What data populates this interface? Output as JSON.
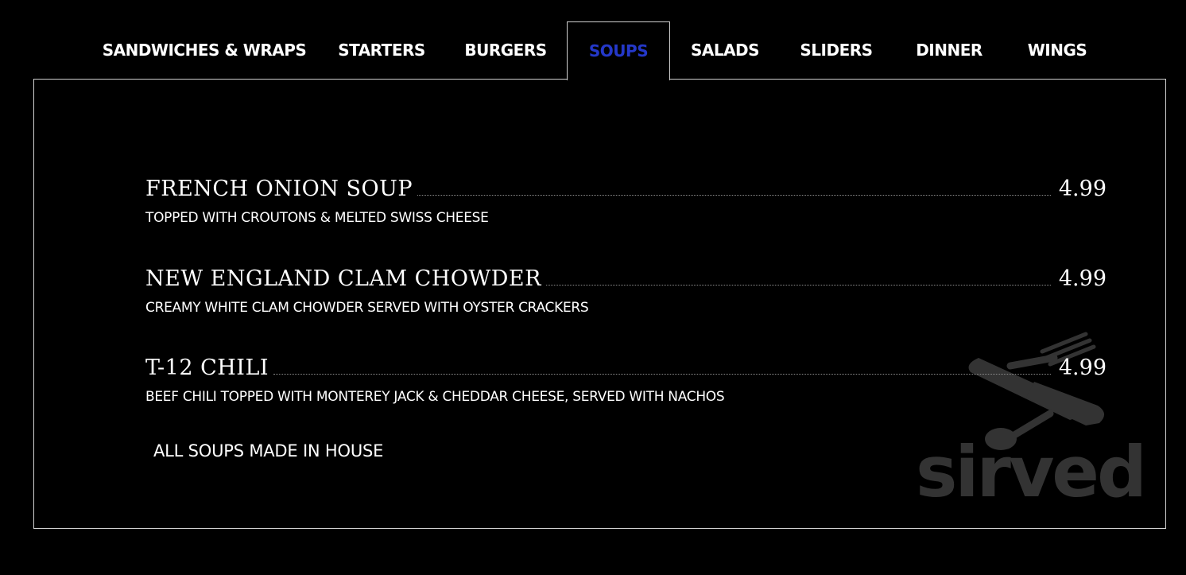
{
  "tabs": [
    {
      "label": "SANDWICHES & WRAPS",
      "active": false
    },
    {
      "label": "STARTERS",
      "active": false
    },
    {
      "label": "BURGERS",
      "active": false
    },
    {
      "label": "SOUPS",
      "active": true
    },
    {
      "label": "SALADS",
      "active": false
    },
    {
      "label": "SLIDERS",
      "active": false
    },
    {
      "label": "DINNER",
      "active": false
    },
    {
      "label": "WINGS",
      "active": false
    }
  ],
  "colors": {
    "background": "#000000",
    "text": "#ffffff",
    "active_tab": "#2438c9",
    "border": "#d0d0d0",
    "watermark": "#333333"
  },
  "menu": {
    "items": [
      {
        "name": "FRENCH ONION SOUP",
        "price": "4.99",
        "description": "TOPPED WITH CROUTONS & MELTED SWISS CHEESE"
      },
      {
        "name": "NEW ENGLAND CLAM CHOWDER",
        "price": "4.99",
        "description": "CREAMY WHITE CLAM CHOWDER SERVED WITH OYSTER CRACKERS"
      },
      {
        "name": "T-12 CHILI",
        "price": "4.99",
        "description": "BEEF CHILI TOPPED WITH MONTEREY JACK & CHEDDAR CHEESE, SERVED WITH NACHOS"
      }
    ],
    "note": "ALL SOUPS MADE IN HOUSE"
  },
  "watermark": {
    "text": "sirved",
    "icon": "fork-knife-spoon-icon"
  }
}
